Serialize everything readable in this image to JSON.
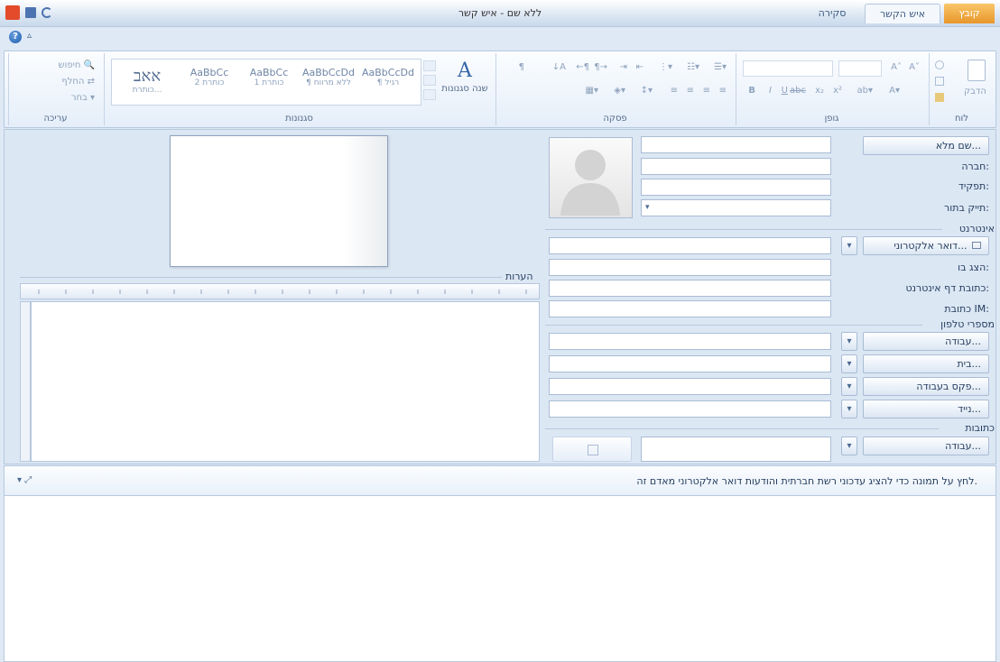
{
  "window": {
    "title": "ללא שם - איש קשר"
  },
  "tabs": {
    "file": "קובץ",
    "contact": "איש הקשר",
    "review": "סקירה"
  },
  "ribbon": {
    "groups": {
      "clipboard": "לוח",
      "font": "גופן",
      "paragraph": "פסקה",
      "styles": "סגנונות",
      "editing": "עריכה"
    },
    "paste_label": "הדבק",
    "change_styles_label": "שנה סגנונות",
    "find_label": "חיפוש",
    "replace_label": "החלף",
    "select_label": "בחר",
    "styles": [
      {
        "sample": "AaBbCcDd",
        "name": "¶ רגיל"
      },
      {
        "sample": "AaBbCcDd",
        "name": "¶ ללא מרווח"
      },
      {
        "sample": "AaBbCc",
        "name": "כותרת 1"
      },
      {
        "sample": "AaBbCc",
        "name": "כותרת 2"
      },
      {
        "sample": "אאב",
        "name": "כותרת..."
      }
    ]
  },
  "form": {
    "full_name_button": "שם מלא...",
    "company_label": "חברה:",
    "job_title_label": "תפקיד:",
    "file_as_label": "תייק בתור:",
    "internet_section": "אינטרנט",
    "email_button": "דואר אלקטרוני...",
    "display_as_label": "הצג בו:",
    "web_page_label": "כתובת דף אינטרנט:",
    "im_label": "כתובת IM:",
    "phones_section": "מספרי טלפון",
    "phone_business": "עבודה...",
    "phone_home": "בית...",
    "phone_business_fax": "פקס בעבודה...",
    "phone_mobile": "נייד...",
    "addresses_section": "כתובות",
    "address_business": "עבודה..."
  },
  "notes": {
    "label": "הערות"
  },
  "people_pane": {
    "message": "לחץ על תמונה כדי להציג עדכוני רשת חברתית והודעות דואר אלקטרוני מאדם זה."
  },
  "colors": {
    "file_tab": "#e8962a",
    "ribbon_bg": "#e5eef9",
    "main_bg": "#dce7f4"
  }
}
